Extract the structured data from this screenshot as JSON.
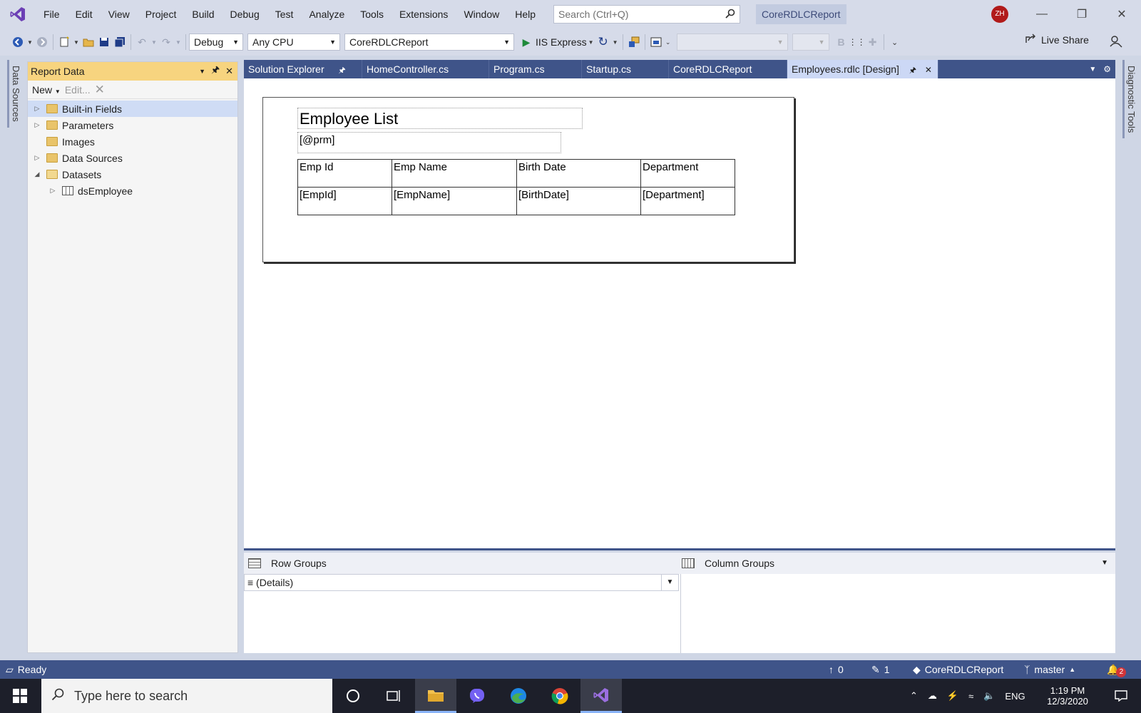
{
  "menu": {
    "items": [
      "File",
      "Edit",
      "View",
      "Project",
      "Build",
      "Debug",
      "Test",
      "Analyze",
      "Tools",
      "Extensions",
      "Window",
      "Help"
    ],
    "search_placeholder": "Search (Ctrl+Q)",
    "solution_name": "CoreRDLCReport",
    "user_initials": "ZH"
  },
  "toolbar": {
    "configuration": "Debug",
    "platform": "Any CPU",
    "startup_project": "CoreRDLCReport",
    "run_target": "IIS Express",
    "bold_label": "B",
    "live_share": "Live Share"
  },
  "left_strip": {
    "label": "Data Sources"
  },
  "right_strip": {
    "label": "Diagnostic Tools"
  },
  "report_panel": {
    "title": "Report Data",
    "new_label": "New",
    "edit_label": "Edit...",
    "tree": [
      {
        "label": "Built-in Fields",
        "expanded": false,
        "selected": true
      },
      {
        "label": "Parameters",
        "expanded": false
      },
      {
        "label": "Images",
        "expanded": null
      },
      {
        "label": "Data Sources",
        "expanded": false
      },
      {
        "label": "Datasets",
        "expanded": true
      },
      {
        "label": "dsEmployee",
        "expanded": false,
        "child": true
      }
    ]
  },
  "doc_tabs": [
    {
      "label": "Solution Explorer",
      "active": false
    },
    {
      "label": "HomeController.cs",
      "active": false
    },
    {
      "label": "Program.cs",
      "active": false
    },
    {
      "label": "Startup.cs",
      "active": false
    },
    {
      "label": "CoreRDLCReport",
      "active": false
    },
    {
      "label": "Employees.rdlc [Design]",
      "active": true
    }
  ],
  "report": {
    "title": "Employee List",
    "param": "[@prm]",
    "headers": [
      "Emp Id",
      "Emp Name",
      "Birth Date",
      "Department"
    ],
    "fields": [
      "[EmpId]",
      "[EmpName]",
      "[BirthDate]",
      "[Department]"
    ]
  },
  "groups": {
    "row_groups_label": "Row Groups",
    "column_groups_label": "Column Groups",
    "details_label": "≡ (Details)"
  },
  "statusbar": {
    "ready": "Ready",
    "up_count": "0",
    "edit_count": "1",
    "repo": "CoreRDLCReport",
    "branch": "master",
    "notifications": "2"
  },
  "taskbar": {
    "search_placeholder": "Type here to search",
    "language": "ENG",
    "time": "1:19 PM",
    "date": "12/3/2020"
  },
  "colors": {
    "accent": "#3f5489",
    "panel_header": "#f7d47f",
    "vs_purple": "#6c3fb5"
  }
}
